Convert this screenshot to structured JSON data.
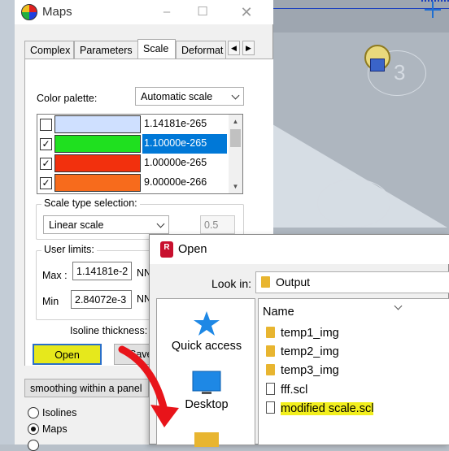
{
  "viewport": {
    "number_label": "3"
  },
  "maps": {
    "title": "Maps",
    "tabs": [
      "Complex",
      "Parameters",
      "Scale",
      "Deformat"
    ],
    "color_palette_label": "Color palette:",
    "color_palette_value": "Automatic scale",
    "palette": [
      {
        "checked": false,
        "color": "#cfe0ff",
        "value": "1.14181e-265",
        "selected": false
      },
      {
        "checked": true,
        "color": "#1fe01f",
        "value": "1.10000e-265",
        "selected": true
      },
      {
        "checked": true,
        "color": "#f2300d",
        "value": "1.00000e-265",
        "selected": false
      },
      {
        "checked": true,
        "color": "#f76b1c",
        "value": "9.00000e-266",
        "selected": false
      }
    ],
    "scale_type_label": "Scale type selection:",
    "scale_type_value": "Linear scale",
    "scale_factor": "0.5",
    "user_limits_label": "User limits:",
    "max_label": "Max :",
    "max_value": "1.14181e-2",
    "max_unit": "NN",
    "min_label": "Min",
    "min_value": "2.84072e-3",
    "min_unit": "NN",
    "isoline_label": "Isoline thickness:",
    "open_button": "Open",
    "save_button": "Save",
    "smoothing_value": "smoothing within a panel",
    "radio_isolines": "Isolines",
    "radio_maps": "Maps"
  },
  "open_dialog": {
    "title": "Open",
    "app_icon_text": "R",
    "look_in_label": "Look in:",
    "look_in_value": "Output",
    "places": [
      "Quick access",
      "Desktop"
    ],
    "column_name": "Name",
    "files": [
      {
        "name": "temp1_img",
        "type": "folder"
      },
      {
        "name": "temp2_img",
        "type": "folder"
      },
      {
        "name": "temp3_img",
        "type": "folder"
      },
      {
        "name": "fff.scl",
        "type": "file"
      },
      {
        "name": "modified scale.scl",
        "type": "file",
        "highlighted": true
      }
    ]
  }
}
